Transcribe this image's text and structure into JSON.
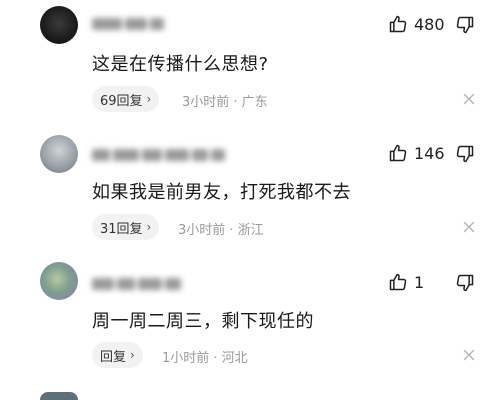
{
  "comments": [
    {
      "likes": "480",
      "text": "这是在传播什么思想?",
      "reply_label": "69回复",
      "meta": "3小时前 · 广东"
    },
    {
      "likes": "146",
      "text": "如果我是前男友，打死我都不去",
      "reply_label": "31回复",
      "meta": "3小时前 · 浙江"
    },
    {
      "likes": "1",
      "text": "周一周二周三，剩下现任的",
      "reply_label": "回复",
      "meta": "1小时前 · 河北"
    }
  ],
  "icons": {
    "like": "thumbs-up-icon",
    "dislike": "thumbs-down-icon",
    "close": "close-icon",
    "chevron": "chevron-right-icon"
  }
}
